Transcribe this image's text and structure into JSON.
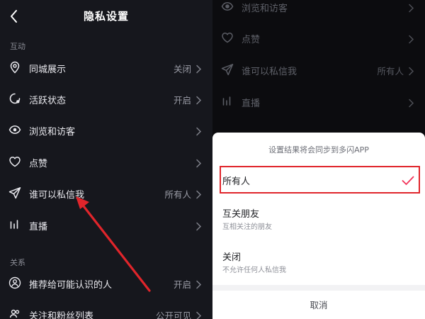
{
  "left": {
    "title": "隐私设置",
    "section_interaction": "互动",
    "section_relations": "关系",
    "items": [
      {
        "label": "同城展示",
        "value": "关闭",
        "icon": "location-pin-icon"
      },
      {
        "label": "活跃状态",
        "value": "开启",
        "icon": "activity-status-icon"
      },
      {
        "label": "浏览和访客",
        "value": "",
        "icon": "eye-icon"
      },
      {
        "label": "点赞",
        "value": "",
        "icon": "heart-icon"
      },
      {
        "label": "谁可以私信我",
        "value": "所有人",
        "icon": "paper-plane-icon"
      },
      {
        "label": "直播",
        "value": "",
        "icon": "live-bars-icon"
      }
    ],
    "relation_items": [
      {
        "label": "推荐给可能认识的人",
        "value": "开启",
        "icon": "person-icon"
      },
      {
        "label": "关注和粉丝列表",
        "value": "公开可见",
        "icon": "people-icon"
      }
    ]
  },
  "right": {
    "bg_items": [
      {
        "label": "浏览和访客",
        "value": "",
        "icon": "eye-icon"
      },
      {
        "label": "点赞",
        "value": "",
        "icon": "heart-icon"
      },
      {
        "label": "谁可以私信我",
        "value": "所有人",
        "icon": "paper-plane-icon"
      },
      {
        "label": "直播",
        "value": "",
        "icon": "live-bars-icon"
      }
    ],
    "sheet": {
      "header": "设置结果将会同步到多闪APP",
      "options": [
        {
          "title": "所有人",
          "subtitle": "",
          "selected": true
        },
        {
          "title": "互关朋友",
          "subtitle": "互相关注的朋友",
          "selected": false
        },
        {
          "title": "关闭",
          "subtitle": "不允许任何人私信我",
          "selected": false
        }
      ],
      "cancel": "取消"
    }
  },
  "colors": {
    "accent_red": "#e0252b",
    "check_pink": "#f2345a",
    "dark_bg": "#16171d"
  }
}
